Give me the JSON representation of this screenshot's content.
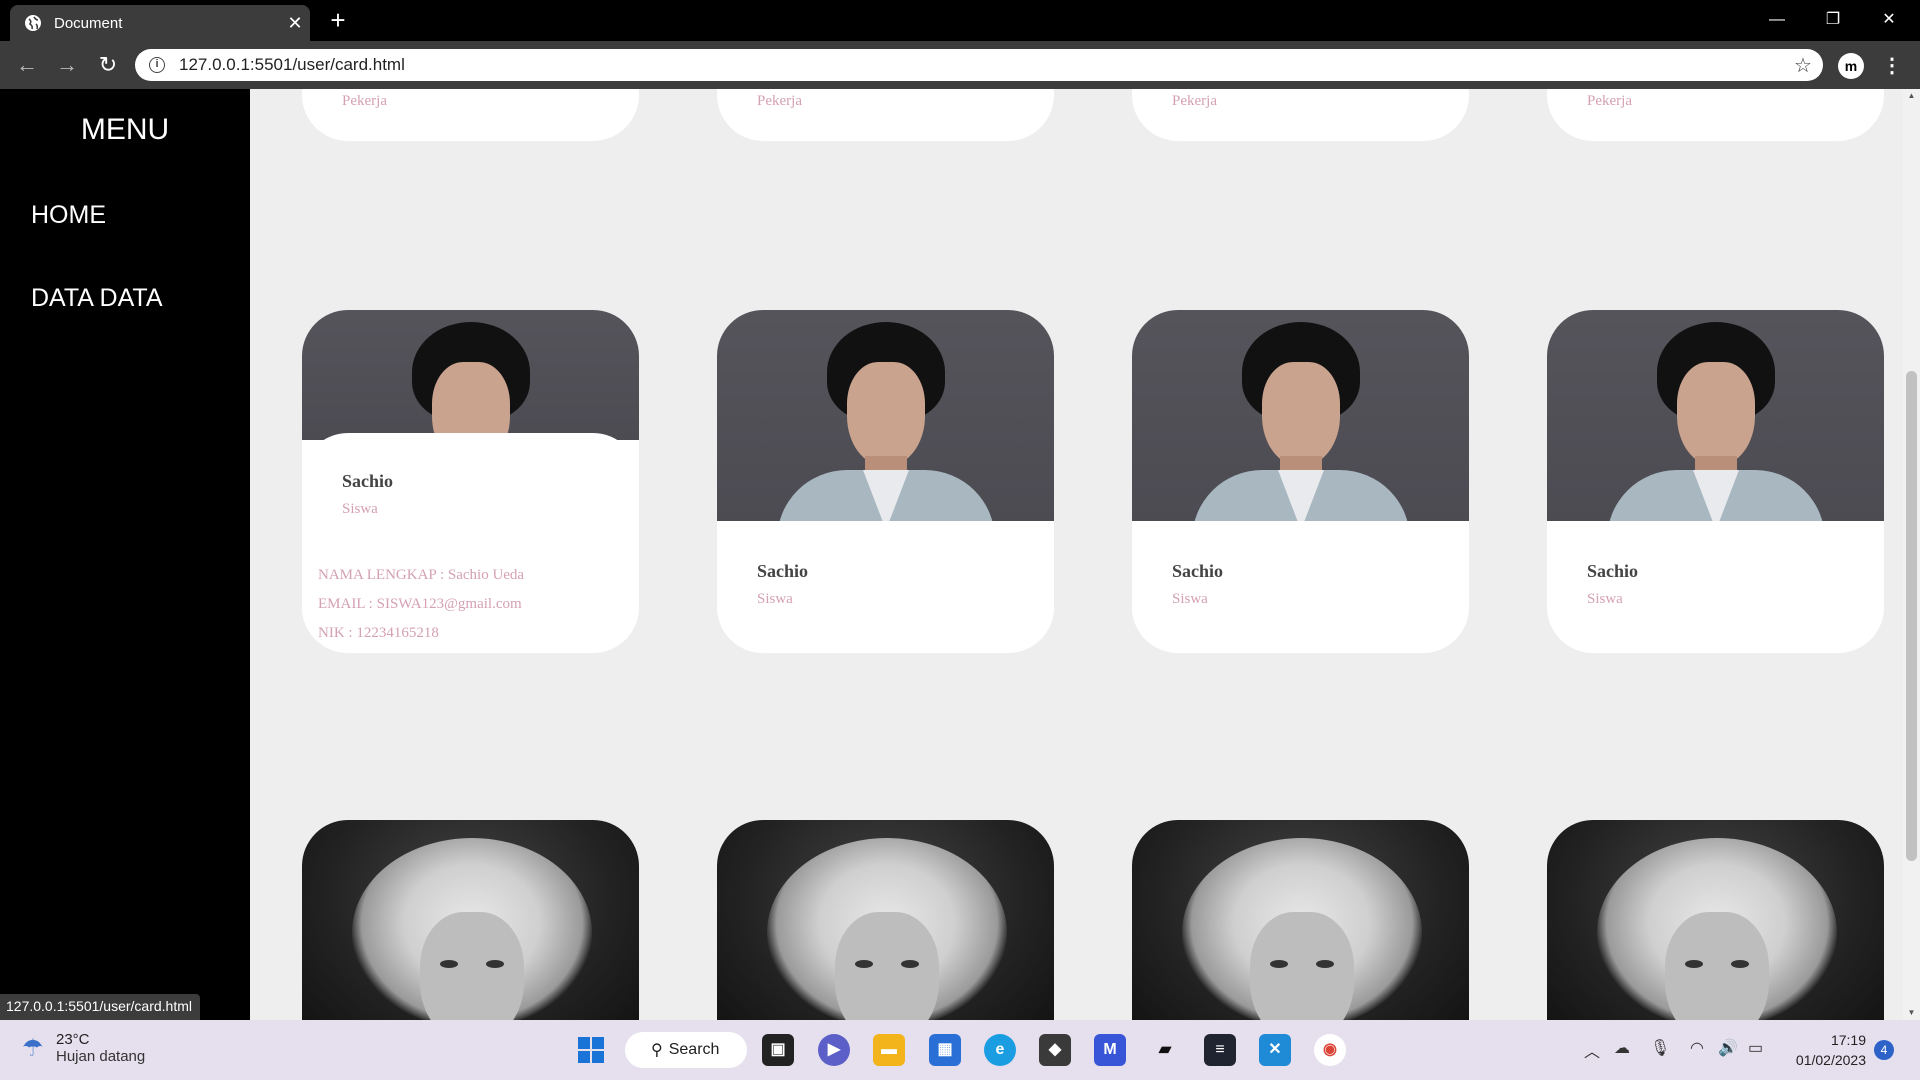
{
  "browser": {
    "tab_title": "Document",
    "tab_close": "✕",
    "new_tab": "+",
    "url": "127.0.0.1:5501/user/card.html",
    "status_url": "127.0.0.1:5501/user/card.html",
    "extension_label": "m"
  },
  "sidebar": {
    "title": "MENU",
    "items": [
      {
        "label": "HOME"
      },
      {
        "label": "DATA DATA"
      }
    ]
  },
  "cards_top_row": [
    {
      "role": "Pekerja"
    },
    {
      "role": "Pekerja"
    },
    {
      "role": "Pekerja"
    },
    {
      "role": "Pekerja"
    }
  ],
  "cards_middle_row": [
    {
      "name": "Sachio",
      "role": "Siswa",
      "expanded": true,
      "details": {
        "full_name": "NAMA LENGKAP : Sachio Ueda",
        "email": "EMAIL : SISWA123@gmail.com",
        "nik": "NIK : 12234165218"
      }
    },
    {
      "name": "Sachio",
      "role": "Siswa",
      "expanded": false
    },
    {
      "name": "Sachio",
      "role": "Siswa",
      "expanded": false
    },
    {
      "name": "Sachio",
      "role": "Siswa",
      "expanded": false
    }
  ],
  "taskbar": {
    "weather_temp": "23°C",
    "weather_desc": "Hujan datang",
    "search_label": "Search",
    "time": "17:19",
    "date": "01/02/2023",
    "notification_count": "4"
  }
}
